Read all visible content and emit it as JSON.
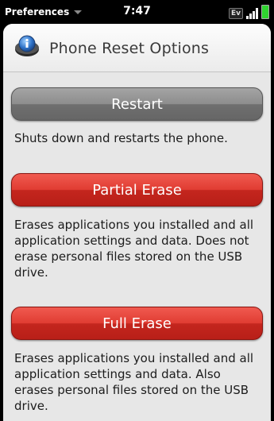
{
  "status_bar": {
    "app_menu_label": "Preferences",
    "time": "7:47",
    "network_label": "Ev"
  },
  "header": {
    "title": "Phone Reset Options",
    "icon": "info-globe-icon"
  },
  "options": [
    {
      "button_label": "Restart",
      "button_style": "gray",
      "description": "Shuts down and restarts the phone."
    },
    {
      "button_label": "Partial Erase",
      "button_style": "red",
      "description": "Erases applications you installed and all application settings and data. Does not erase personal files stored on the USB drive."
    },
    {
      "button_label": "Full Erase",
      "button_style": "red",
      "description": "Erases applications you installed and all application settings and data. Also erases personal files stored on the USB drive."
    }
  ],
  "colors": {
    "accent_red": "#e03c32",
    "button_gray": "#8d8d8d",
    "background": "#e7e7e7",
    "battery_green": "#2fd32f"
  }
}
